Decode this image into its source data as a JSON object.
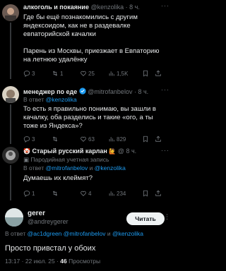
{
  "tweets": [
    {
      "name": "алкоголь и покаяние",
      "handle": "@kenzolika",
      "time": "· 8 ч.",
      "text_line1": "Где бы ещё познакомились с другим",
      "text_line2": "яндексоидом, как не в раздевалке",
      "text_line3": "евпаторийской качалки",
      "text_line4": "Парень из Москвы, приезжает в Евпаторию",
      "text_line5": "на летнюю удалёнку",
      "replies": "3",
      "retweets": "1",
      "likes": "25",
      "views": "1,5K"
    },
    {
      "name": "менеджер по еде",
      "handle": "@mitrofanbelov",
      "time": "· 8 ч.",
      "reply_prefix": "В ответ",
      "reply_mention": "@kenzolika",
      "text_line1": "То есть я правильно понимаю, вы зашли в",
      "text_line2": "качалку, оба разделись и такие «ого, а ты",
      "text_line3": "тоже из Яндекса»?",
      "replies": "3",
      "retweets": "",
      "likes": "63",
      "views": "829"
    },
    {
      "name": "Старый русский карлан",
      "handle": "@",
      "time": "8 ч.",
      "parody_label": "Пародийная учетная запись",
      "reply_prefix": "В ответ",
      "reply_mention1": "@mitrofanbelov",
      "reply_and": "и",
      "reply_mention2": "@kenzolika",
      "text_line1": "Думаешь их клеймят?",
      "replies": "1",
      "retweets": "",
      "likes": "4",
      "views": "234"
    }
  ],
  "main_tweet": {
    "name": "gerer",
    "handle": "@andreygerer",
    "follow_label": "Читать",
    "reply_prefix": "В ответ",
    "reply_mention1": "@ac1dgreen",
    "reply_mention2": "@mitrofanbelov",
    "reply_and": "и",
    "reply_mention3": "@kenzolika",
    "text": "Просто привстал у обоих",
    "timestamp": "13:17 · 22 июл. 25 ·",
    "views_count": "46",
    "views_label": "Просмотры"
  },
  "icons": [
    "reply-icon",
    "retweet-icon",
    "like-icon",
    "views-icon",
    "bookmark-icon",
    "share-icon",
    "more-icon",
    "verified-icon"
  ],
  "colors": {
    "background": "#000000",
    "text": "#e7e9ea",
    "muted": "#71767b",
    "accent": "#1d9bf0",
    "divider": "#2f3336"
  }
}
